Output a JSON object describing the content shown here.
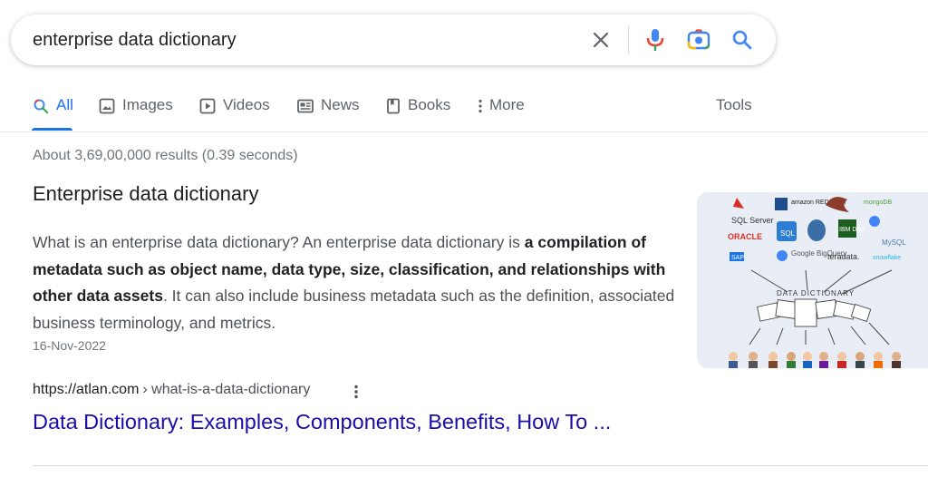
{
  "search": {
    "query": "enterprise data dictionary"
  },
  "icons": {
    "clear": "close-icon",
    "voice": "microphone-icon",
    "lens": "camera-icon",
    "submit": "search-icon"
  },
  "colors": {
    "accent": "#1a73e8",
    "link": "#1a0dab",
    "mic_blue": "#4285f4",
    "mic_red": "#ea4335"
  },
  "tabs": [
    {
      "label": "All",
      "icon": "search-icon",
      "active": true
    },
    {
      "label": "Images",
      "icon": "image-icon"
    },
    {
      "label": "Videos",
      "icon": "play-icon"
    },
    {
      "label": "News",
      "icon": "news-icon"
    },
    {
      "label": "Books",
      "icon": "book-icon"
    },
    {
      "label": "More",
      "icon": "more-vertical-icon"
    }
  ],
  "tools_label": "Tools",
  "result_stats": "About 3,69,00,000 results (0.39 seconds)",
  "featured": {
    "title": "Enterprise data dictionary",
    "body_pre": "What is an enterprise data dictionary? An enterprise data dictionary is ",
    "body_bold": "a compilation of metadata such as object name, data type, size, classification, and relationships with other data assets",
    "body_post": ". It can also include business metadata such as the definition, associated business terminology, and metrics.",
    "date": "16-Nov-2022",
    "thumbnail": {
      "logos": [
        "SQL Server",
        "amazon REDSHIFT",
        "mongoDB",
        "ORACLE",
        "SQL",
        "IBM DB2",
        "Google BigQuery",
        "teradata.",
        "MySQL",
        "SAP",
        "snowflake"
      ],
      "caption": "DATA DICTIONARY"
    },
    "cite_domain": "https://atlan.com",
    "cite_path": "› what-is-a-data-dictionary",
    "link_title": "Data Dictionary: Examples, Components, Benefits, How To ..."
  }
}
